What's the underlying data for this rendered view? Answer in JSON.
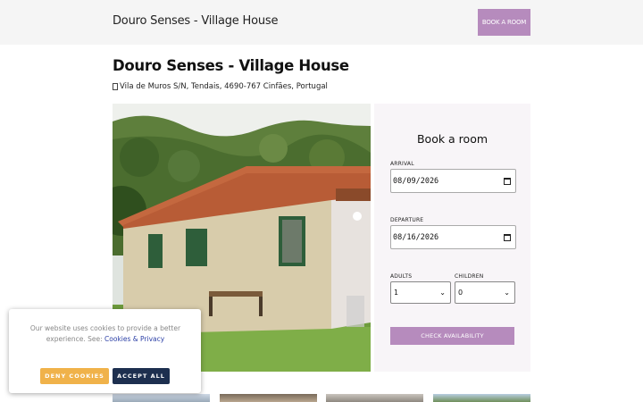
{
  "header": {
    "brand": "Douro Senses - Village House",
    "book_button": "BOOK A ROOM"
  },
  "property": {
    "title": "Douro Senses - Village House",
    "address": "Vila de Muros S/N, Tendais, 4690-767 Cinfães, Portugal",
    "address_icon": "map-pin-icon"
  },
  "booking": {
    "heading": "Book a room",
    "arrival_label": "ARRIVAL",
    "arrival_value": "08/09/2026",
    "departure_label": "DEPARTURE",
    "departure_value": "08/16/2026",
    "adults_label": "ADULTS",
    "adults_value": "1",
    "children_label": "CHILDREN",
    "children_value": "0",
    "check_button": "CHECK AVAILABILITY"
  },
  "cookie": {
    "text": "Our website uses cookies to provide a better experience. See:",
    "link": "Cookies & Privacy",
    "deny": "DENY COOKIES",
    "accept": "ACCEPT ALL"
  },
  "colors": {
    "accent": "#b68bbd",
    "cookie_deny": "#f0b24a",
    "cookie_accept": "#1d2f4f"
  }
}
